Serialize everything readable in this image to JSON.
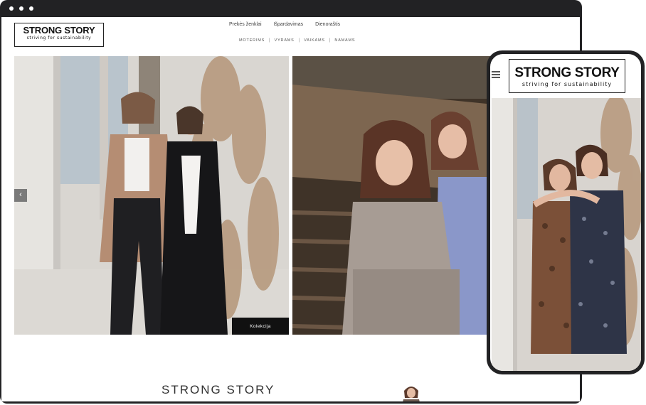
{
  "site": {
    "brand": "STRONG STORY",
    "tagline": "striving for sustainability"
  },
  "nav": {
    "top": [
      {
        "label": "Prekės ženklai"
      },
      {
        "label": "Išpardavimas"
      },
      {
        "label": "Dienoraštis"
      }
    ],
    "categories": [
      {
        "label": "MOTERIMS"
      },
      {
        "label": "VYRAMS"
      },
      {
        "label": "VAIKAMS"
      },
      {
        "label": "NAMAMS"
      }
    ],
    "separator": "|"
  },
  "hero": {
    "prev_icon": "‹",
    "cta_label": "Kolekcija"
  },
  "section": {
    "title": "STRONG STORY"
  },
  "colors": {
    "frame": "#222224",
    "cta_bg": "#111111",
    "arrow_bg": "#7a7a7a"
  },
  "icons": [
    "chevron-left-icon",
    "hamburger-menu-icon"
  ]
}
